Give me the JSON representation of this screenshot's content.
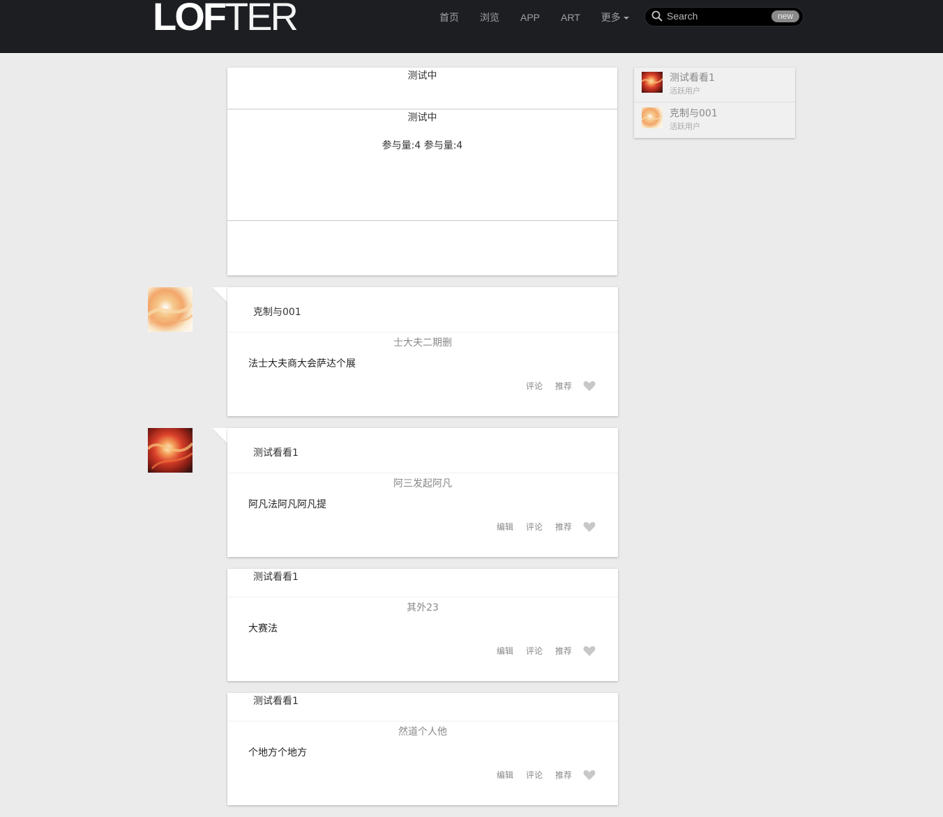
{
  "brand": {
    "logo_bold": "LOF",
    "logo_thin": "TER"
  },
  "nav": {
    "items": [
      {
        "label": "首页"
      },
      {
        "label": "浏览"
      },
      {
        "label": "APP"
      },
      {
        "label": "ART"
      },
      {
        "label": "更多"
      }
    ]
  },
  "search": {
    "placeholder": "Search",
    "badge": "new"
  },
  "vote_card": {
    "title": "测试中",
    "subtitle": "测试中",
    "stats": "参与量:4 参与量:4"
  },
  "posts": [
    {
      "author": "克制与001",
      "title": "士大夫二期删",
      "body": "法士大夫商大会萨达个展",
      "actions": [
        "评论",
        "推荐"
      ],
      "has_avatar": true
    },
    {
      "author": "测试看看1",
      "title": "阿三发起阿凡",
      "body": "阿凡法阿凡阿凡提",
      "actions": [
        "编辑",
        "评论",
        "推荐"
      ],
      "has_avatar": true
    },
    {
      "author": "测试看看1",
      "title": "其外23",
      "body": "大赛法",
      "actions": [
        "编辑",
        "评论",
        "推荐"
      ],
      "has_avatar": false
    },
    {
      "author": "测试看看1",
      "title": "然道个人他",
      "body": "个地方个地方",
      "actions": [
        "编辑",
        "评论",
        "推荐"
      ],
      "has_avatar": false
    }
  ],
  "sidebar": {
    "users": [
      {
        "name": "测试看看1",
        "status": "活跃用户"
      },
      {
        "name": "克制与001",
        "status": "活跃用户"
      }
    ]
  },
  "colors": {
    "topbar": "#1c1e22",
    "background": "#ebebec",
    "heart": "#c8c8c8"
  }
}
